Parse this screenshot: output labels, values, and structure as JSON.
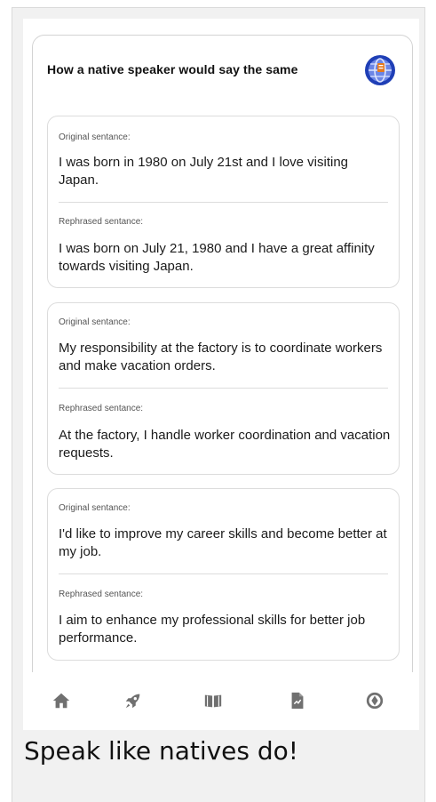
{
  "panel": {
    "title": "How a native speaker would say the same"
  },
  "cards": [
    {
      "original_label": "Original sentance:",
      "original_text": "I was born in 1980 on July 21st and I love visiting Japan.",
      "rephrased_label": "Rephrased sentance:",
      "rephrased_text": "I was born on July 21, 1980 and I have a great affinity towards visiting Japan."
    },
    {
      "original_label": "Original sentance:",
      "original_text": "My responsibility at the factory is to coordinate workers and make vacation orders.",
      "rephrased_label": "Rephrased sentance:",
      "rephrased_text": "At the factory, I handle worker coordination and vacation requests."
    },
    {
      "original_label": "Original sentance:",
      "original_text": "I'd like to improve my career skills and become better at my job.",
      "rephrased_label": "Rephrased sentance:",
      "rephrased_text": "I aim to enhance my professional skills for better job performance."
    }
  ],
  "nav": {
    "items": [
      "home-icon",
      "rocket-icon",
      "book-icon",
      "document-icon",
      "globe-icon"
    ],
    "icon_color": "#707070"
  },
  "tagline": "Speak like natives do!",
  "colors": {
    "frame_bg": "#f1f1f1",
    "logo_blue": "#1f3fb6",
    "logo_accent": "#e57a1f"
  }
}
